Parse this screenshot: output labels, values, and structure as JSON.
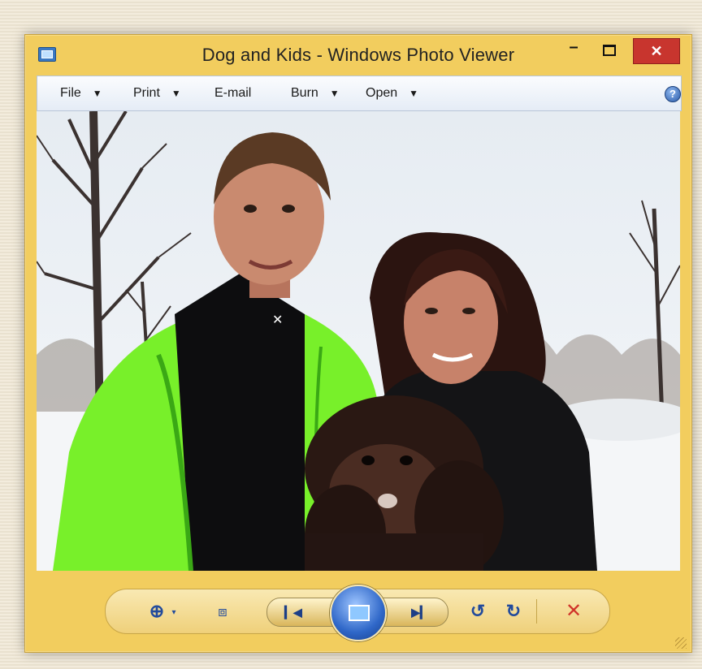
{
  "window": {
    "title": "Dog and Kids - Windows Photo Viewer",
    "frame_color": "#f2cd5e",
    "close_color": "#c8352e"
  },
  "titlebar": {
    "app_icon": "photo-viewer-icon",
    "minimize_icon": "minimize-icon",
    "minimize_glyph": "–",
    "maximize_icon": "maximize-icon",
    "close_icon": "close-icon",
    "close_glyph": "✕"
  },
  "menubar": {
    "items": [
      {
        "label": "File",
        "caret": "▼"
      },
      {
        "label": "Print",
        "caret": "▼"
      },
      {
        "label": "E-mail",
        "caret": ""
      },
      {
        "label": "Burn",
        "caret": "▼"
      },
      {
        "label": "Open",
        "caret": "▼"
      }
    ],
    "help_icon": "help-icon",
    "help_glyph": "?"
  },
  "photo": {
    "description_icon": "photo-canvas"
  },
  "controls": {
    "zoom_glyph": "⊕",
    "zoom_caret": "▾",
    "fit_glyph": "⧈",
    "prev_glyph": "▎◀",
    "next_glyph": "▶▎",
    "rotate_left_glyph": "↺",
    "rotate_right_glyph": "↻",
    "delete_glyph": "✕",
    "icons": [
      "zoom-icon",
      "actual-size-icon",
      "previous-icon",
      "slideshow-icon",
      "next-icon",
      "rotate-left-icon",
      "rotate-right-icon",
      "delete-icon"
    ]
  }
}
